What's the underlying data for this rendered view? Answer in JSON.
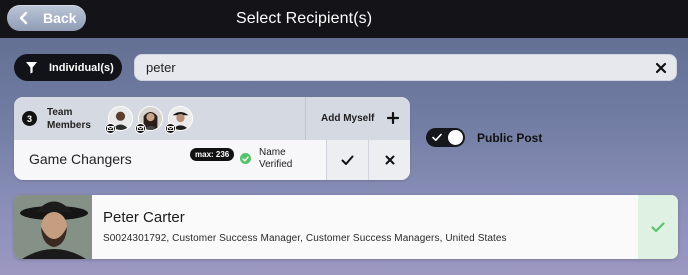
{
  "header": {
    "back_label": "Back",
    "title": "Select Recipient(s)",
    "background_color": "#141418"
  },
  "filter": {
    "label": "Individual(s)",
    "icon": "funnel-icon"
  },
  "search": {
    "value": "peter",
    "clear_icon": "close-icon"
  },
  "team": {
    "member_count": "3",
    "label_line1": "Team",
    "label_line2": "Members",
    "members": [
      {
        "avatar": "avatar-1",
        "icon": "mail-icon"
      },
      {
        "avatar": "avatar-2",
        "icon": "mail-icon"
      },
      {
        "avatar": "avatar-3",
        "icon": "mail-icon"
      }
    ],
    "add_myself_label": "Add Myself",
    "name": "Game Changers",
    "max_badge": "max: 236",
    "verified_line1": "Name",
    "verified_line2": "Verified",
    "verified_color": "#55c46a"
  },
  "public_post": {
    "label": "Public Post",
    "enabled": true
  },
  "results": [
    {
      "name": "Peter Carter",
      "details": "S0024301792, Customer Success Manager, Customer Success Managers, United States",
      "selected": true,
      "accent_color": "#5cc46c"
    }
  ]
}
